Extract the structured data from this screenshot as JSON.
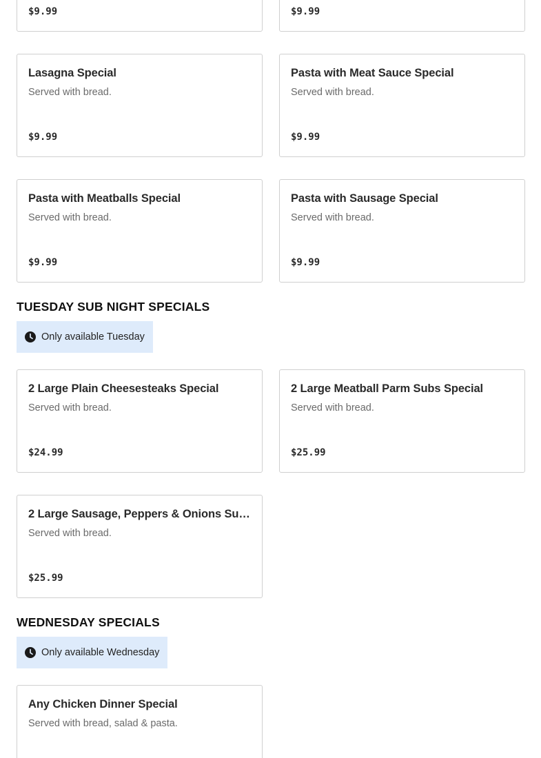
{
  "top_prices": {
    "left": "$9.99",
    "right": "$9.99"
  },
  "items": [
    {
      "name": "Lasagna Special",
      "desc": "Served with bread.",
      "price": "$9.99"
    },
    {
      "name": "Pasta with Meat Sauce Special",
      "desc": "Served with bread.",
      "price": "$9.99"
    },
    {
      "name": "Pasta with Meatballs Special",
      "desc": "Served with bread.",
      "price": "$9.99"
    },
    {
      "name": "Pasta with Sausage Special",
      "desc": "Served with bread.",
      "price": "$9.99"
    }
  ],
  "tuesday": {
    "title": "TUESDAY SUB NIGHT SPECIALS",
    "availability": "Only available Tuesday",
    "items": [
      {
        "name": "2 Large Plain Cheesesteaks Special",
        "desc": "Served with bread.",
        "price": "$24.99"
      },
      {
        "name": "2 Large Meatball Parm Subs Special",
        "desc": "Served with bread.",
        "price": "$25.99"
      },
      {
        "name": "2 Large Sausage, Peppers & Onions Subs...",
        "desc": "Served with bread.",
        "price": "$25.99"
      }
    ]
  },
  "wednesday": {
    "title": "WEDNESDAY SPECIALS",
    "availability": "Only available Wednesday",
    "items": [
      {
        "name": "Any Chicken Dinner Special",
        "desc": "Served with bread, salad & pasta."
      }
    ]
  },
  "icons": {
    "availability": "clock-icon"
  }
}
